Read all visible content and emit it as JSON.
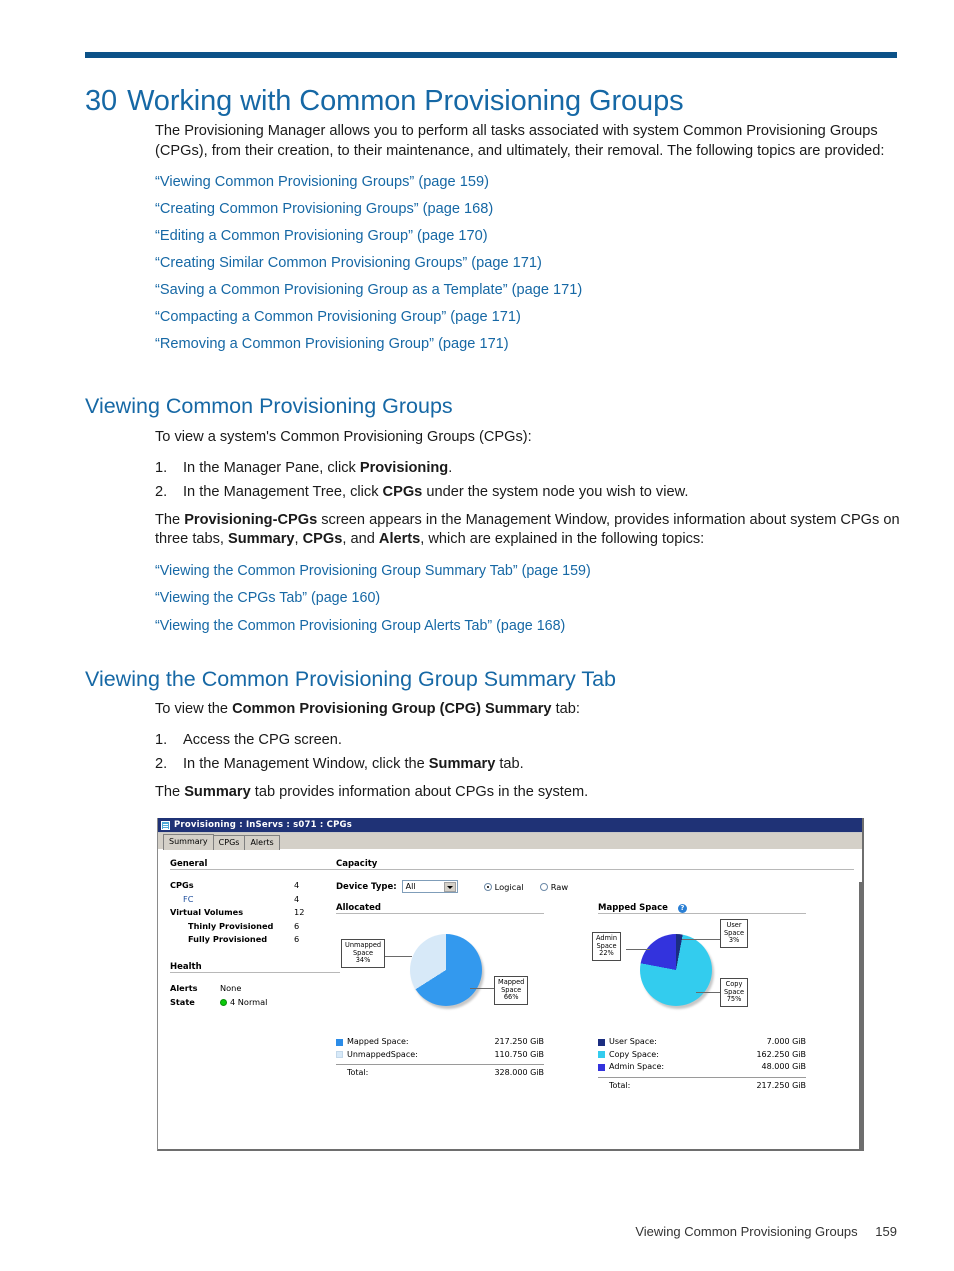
{
  "page": {
    "chapter_number": "30",
    "chapter_title": "Working with Common Provisioning Groups",
    "footer_title": "Viewing Common Provisioning Groups",
    "footer_page": "159",
    "accent_rule_color": "#0c5288",
    "heading_color": "#1668a5",
    "link_color": "#1668a5"
  },
  "intro": {
    "paragraph": "The Provisioning Manager allows you to perform all tasks associated with system Common Provisioning Groups (CPGs), from their creation, to their maintenance, and ultimately, their removal. The following topics are provided:",
    "links": [
      "“Viewing Common Provisioning Groups” (page 159)",
      "“Creating Common Provisioning Groups” (page 168)",
      "“Editing a Common Provisioning Group” (page 170)",
      "“Creating Similar Common Provisioning Groups” (page 171)",
      "“Saving a Common Provisioning Group as a Template” (page 171)",
      "“Compacting a Common Provisioning Group” (page 171)",
      "“Removing a Common Provisioning Group” (page 171)"
    ]
  },
  "section_viewing": {
    "heading": "Viewing Common Provisioning Groups",
    "lead": "To view a system's Common Provisioning Groups (CPGs):",
    "steps": [
      {
        "marker": "1.",
        "pre": "In the Manager Pane, click ",
        "bold": "Provisioning",
        "post": "."
      },
      {
        "marker": "2.",
        "pre": "In the Management Tree, click ",
        "bold": "CPGs",
        "post": " under the system node you wish to view."
      }
    ],
    "after_paragraph_1": "The ",
    "after_bold_1": "Provisioning-CPGs",
    "after_paragraph_2": " screen appears in the Management Window, provides information about system CPGs on three tabs, ",
    "after_bold_2": "Summary",
    "after_paragraph_3": ", ",
    "after_bold_3": "CPGs",
    "after_paragraph_4": ", and ",
    "after_bold_4": "Alerts",
    "after_paragraph_5": ", which are explained in the following topics:",
    "links": [
      "“Viewing the Common Provisioning Group Summary Tab” (page 159)",
      "“Viewing the CPGs Tab” (page 160)",
      "“Viewing the Common Provisioning Group Alerts Tab” (page 168)"
    ]
  },
  "section_summary_tab": {
    "heading": "Viewing the Common Provisioning Group Summary Tab",
    "lead_pre": "To view the ",
    "lead_bold": "Common Provisioning Group (CPG) Summary",
    "lead_post": " tab:",
    "steps": [
      {
        "marker": "1.",
        "pre": "Access the CPG screen.",
        "bold": "",
        "post": ""
      },
      {
        "marker": "2.",
        "pre": "In the Management Window, click the ",
        "bold": "Summary",
        "post": " tab."
      }
    ],
    "closing_pre": "The ",
    "closing_bold": "Summary",
    "closing_post": " tab provides information about CPGs in the system."
  },
  "app": {
    "window_title": "Provisioning : InServs : s071 : CPGs",
    "titlebar_color": "#1f3276",
    "tabs": [
      {
        "label": "Summary",
        "active": true
      },
      {
        "label": "CPGs",
        "active": false
      },
      {
        "label": "Alerts",
        "active": false
      }
    ],
    "general": {
      "title": "General",
      "rows": [
        {
          "label": "CPGs",
          "value": "4",
          "style": "bold"
        },
        {
          "label": "FC",
          "value": "4",
          "style": "sub-link"
        },
        {
          "label": "Virtual Volumes",
          "value": "12",
          "style": "bold"
        },
        {
          "label": "Thinly Provisioned",
          "value": "6",
          "style": "indent-bold"
        },
        {
          "label": "Fully Provisioned",
          "value": "6",
          "style": "indent-bold"
        }
      ]
    },
    "health": {
      "title": "Health",
      "alerts_label": "Alerts",
      "alerts_value": "None",
      "state_label": "State",
      "state_value": "4 Normal",
      "state_dot_color": "#0bca0b"
    },
    "capacity": {
      "title": "Capacity",
      "device_type_label": "Device Type:",
      "device_type_value": "All",
      "radio_logical": "Logical",
      "radio_raw": "Raw",
      "radio_selected": "Logical"
    },
    "allocated_panel": {
      "title": "Allocated",
      "help_icon": "question-mark-icon"
    },
    "mapped_panel": {
      "title": "Mapped Space",
      "help_icon": "question-mark-icon"
    }
  },
  "chart_data": [
    {
      "type": "pie",
      "title": "Allocated",
      "labels": [
        "Mapped Space",
        "Unmapped Space"
      ],
      "percents": [
        66,
        34
      ],
      "colors": [
        "#3399ee",
        "#d7e9f8"
      ],
      "callouts": [
        "Mapped Space 66%",
        "Unmapped Space 34%"
      ],
      "legend_position": "bottom",
      "legend": [
        {
          "name": "Mapped Space:",
          "value": "217.250 GiB",
          "color": "#2b8ce8"
        },
        {
          "name": "UnmappedSpace:",
          "value": "110.750 GiB",
          "color": "#d7e9f8"
        }
      ],
      "total_label": "Total:",
      "total_value": "328.000 GiB"
    },
    {
      "type": "pie",
      "title": "Mapped Space",
      "labels": [
        "User Space",
        "Copy Space",
        "Admin Space"
      ],
      "percents": [
        3,
        75,
        22
      ],
      "colors": [
        "#1b2d80",
        "#33ccee",
        "#3333dd"
      ],
      "callouts": [
        "User Space 3%",
        "Copy Space 75%",
        "Admin Space 22%"
      ],
      "legend_position": "bottom",
      "legend": [
        {
          "name": "User Space:",
          "value": "7.000 GiB",
          "color": "#1b2d80"
        },
        {
          "name": "Copy Space:",
          "value": "162.250 GiB",
          "color": "#33ccee"
        },
        {
          "name": "Admin Space:",
          "value": "48.000 GiB",
          "color": "#3333dd"
        }
      ],
      "total_label": "Total:",
      "total_value": "217.250 GiB"
    }
  ],
  "callouts": {
    "left": [
      {
        "l1": "Unmapped",
        "l2": "Space",
        "l3": "34%"
      },
      {
        "l1": "Mapped",
        "l2": "Space",
        "l3": "66%"
      }
    ],
    "right": [
      {
        "l1": "User",
        "l2": "Space",
        "l3": "3%"
      },
      {
        "l1": "Admin",
        "l2": "Space",
        "l3": "22%"
      },
      {
        "l1": "Copy",
        "l2": "Space",
        "l3": "75%"
      }
    ]
  }
}
